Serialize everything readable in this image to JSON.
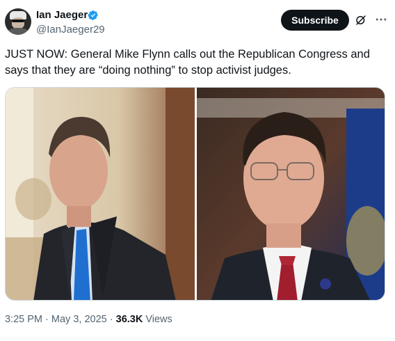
{
  "author": {
    "display_name": "Ian Jaeger",
    "handle": "@IanJaeger29",
    "verified_color": "#1d9bf0"
  },
  "actions": {
    "subscribe_label": "Subscribe"
  },
  "tweet": {
    "text": "JUST NOW: General Mike Flynn calls out the Republican Congress and says that they are “doing nothing” to stop activist judges."
  },
  "meta": {
    "time": "3:25 PM",
    "separator": "·",
    "date": "May 3, 2025",
    "views_count": "36.3K",
    "views_label": "Views"
  },
  "icons": {
    "verified": "verified-badge-icon",
    "grok": "grok-icon",
    "more": "more-icon"
  }
}
